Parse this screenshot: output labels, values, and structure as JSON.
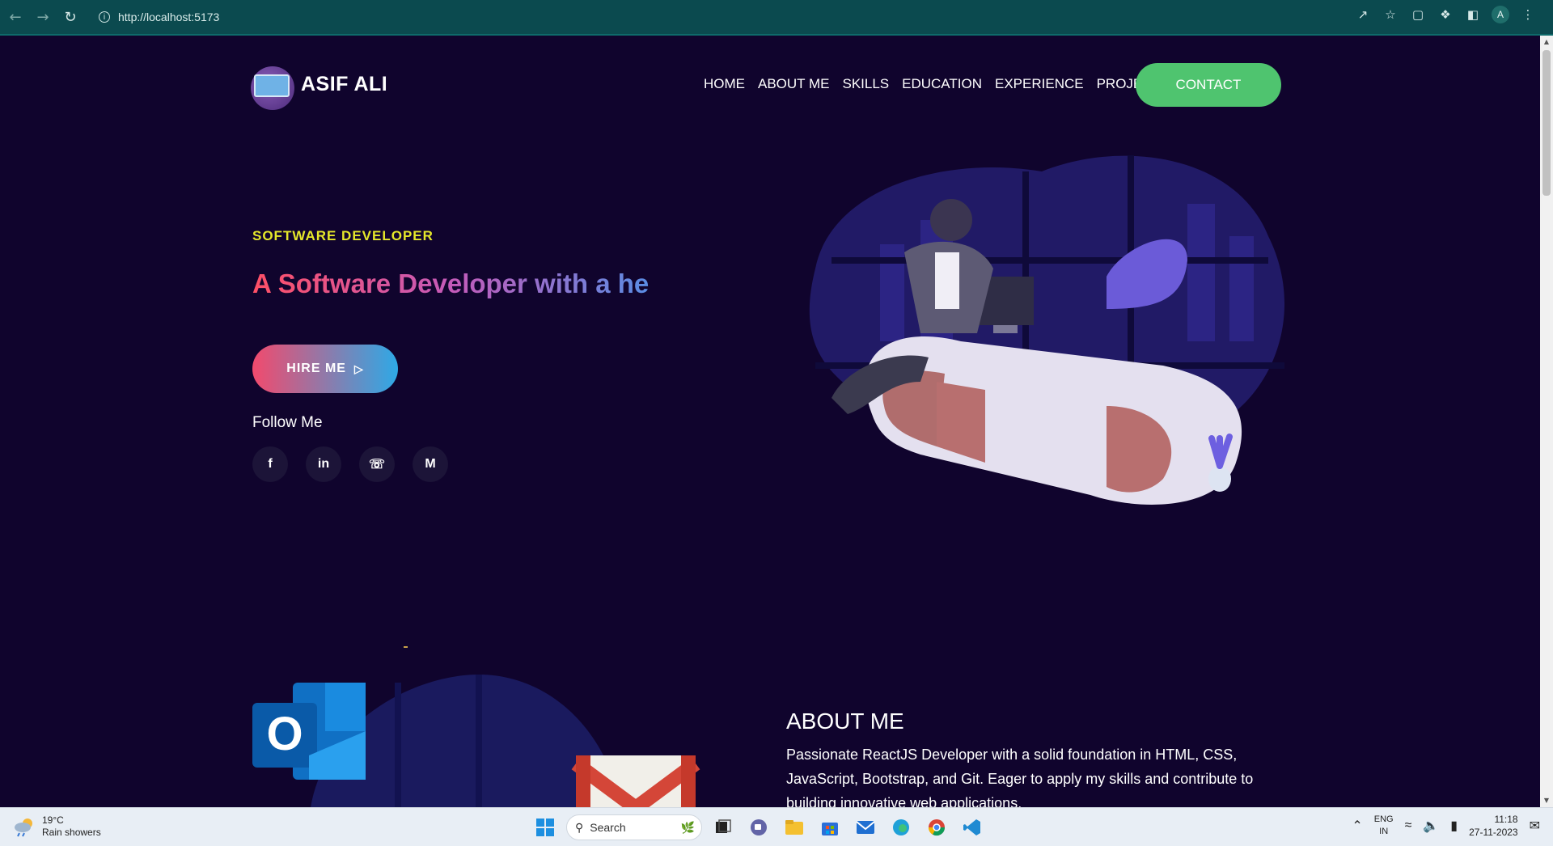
{
  "browser": {
    "url": "http://localhost:5173",
    "profile_initial": "A",
    "icons": [
      "back-icon",
      "forward-icon",
      "reload-icon",
      "info-icon",
      "share-icon",
      "star-icon",
      "extension-square-icon",
      "puzzle-icon",
      "sidebar-icon"
    ]
  },
  "header": {
    "logo_text": "ASIF ALI",
    "menu": [
      "HOME",
      "ABOUT ME",
      "SKILLS",
      "EDUCATION",
      "EXPERIENCE",
      "PROJECTS"
    ],
    "contact_label": "CONTACT"
  },
  "hero": {
    "eyebrow": "SOFTWARE DEVELOPER",
    "headline": "A Software Developer with a he",
    "hire_label": "HIRE ME",
    "follow_label": "Follow Me",
    "socials": [
      {
        "name": "facebook-icon",
        "glyph": "f"
      },
      {
        "name": "linkedin-icon",
        "glyph": "in"
      },
      {
        "name": "whatsapp-icon",
        "glyph": "☏"
      },
      {
        "name": "gmail-icon",
        "glyph": "M"
      }
    ]
  },
  "about": {
    "title": "ABOUT ME",
    "text": "Passionate ReactJS Developer with a solid foundation in HTML, CSS, JavaScript, Bootstrap, and Git. Eager to apply my skills and contribute to building innovative web applications."
  },
  "colors": {
    "page_bg": "#10042d",
    "eyebrow": "#e6e82a",
    "contact_bg": "#4fc46f",
    "chrome_bg": "#0b4a4f"
  },
  "taskbar": {
    "weather_temp": "19°C",
    "weather_desc": "Rain showers",
    "search_placeholder": "Search",
    "lang_line1": "ENG",
    "lang_line2": "IN",
    "time": "11:18",
    "date": "27-11-2023"
  }
}
